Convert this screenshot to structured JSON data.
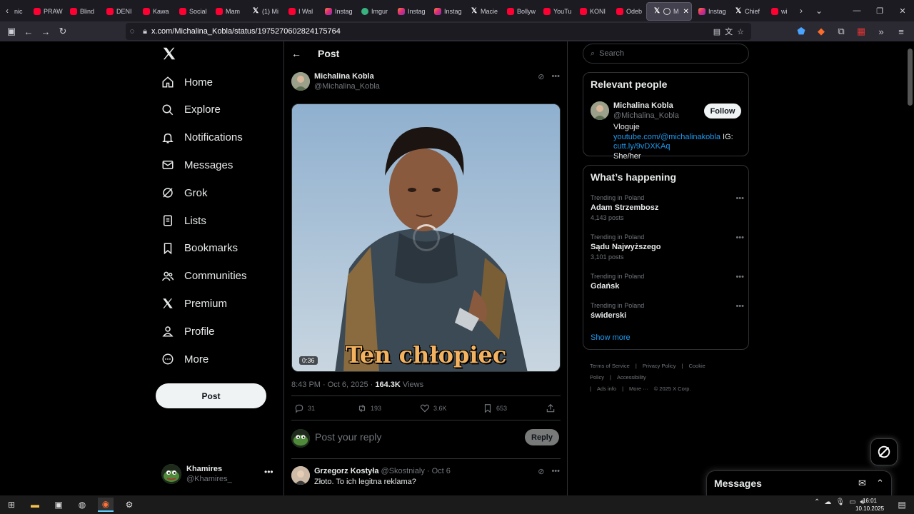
{
  "browser": {
    "tabs": [
      {
        "label": "nic",
        "icon": "tab-nav-left"
      },
      {
        "label": "PRAW",
        "icon": "youtube"
      },
      {
        "label": "Blind",
        "icon": "youtube"
      },
      {
        "label": "DENI",
        "icon": "youtube"
      },
      {
        "label": "Kawa",
        "icon": "youtube"
      },
      {
        "label": "Social",
        "icon": "youtube"
      },
      {
        "label": "Mam",
        "icon": "youtube"
      },
      {
        "label": "(1) Mi",
        "icon": "x"
      },
      {
        "label": "I Wal",
        "icon": "youtube"
      },
      {
        "label": "Instag",
        "icon": "instagram"
      },
      {
        "label": "Imgur",
        "icon": "imgur"
      },
      {
        "label": "Instag",
        "icon": "instagram"
      },
      {
        "label": "Instag",
        "icon": "instagram"
      },
      {
        "label": "Macie",
        "icon": "x"
      },
      {
        "label": "Bollyw",
        "icon": "youtube"
      },
      {
        "label": "YouTu",
        "icon": "youtube"
      },
      {
        "label": "KONI",
        "icon": "youtube"
      },
      {
        "label": "Odeb",
        "icon": "youtube"
      },
      {
        "label": "M",
        "icon": "x",
        "active": true
      },
      {
        "label": "Instag",
        "icon": "instagram"
      },
      {
        "label": "Chief",
        "icon": "x"
      },
      {
        "label": "wi",
        "icon": "youtube"
      }
    ],
    "url": "x.com/Michalina_Kobla/status/1975270602824175764"
  },
  "nav": {
    "items": [
      {
        "label": "Home",
        "icon": "home-icon"
      },
      {
        "label": "Explore",
        "icon": "search-icon"
      },
      {
        "label": "Notifications",
        "icon": "bell-icon"
      },
      {
        "label": "Messages",
        "icon": "envelope-icon"
      },
      {
        "label": "Grok",
        "icon": "grok-icon"
      },
      {
        "label": "Lists",
        "icon": "list-icon"
      },
      {
        "label": "Bookmarks",
        "icon": "bookmark-icon"
      },
      {
        "label": "Communities",
        "icon": "people-icon"
      },
      {
        "label": "Premium",
        "icon": "x-icon"
      },
      {
        "label": "Profile",
        "icon": "person-icon"
      },
      {
        "label": "More",
        "icon": "more-circle-icon"
      }
    ],
    "post_label": "Post",
    "account": {
      "name": "Khamires",
      "handle": "@Khamires_"
    }
  },
  "post": {
    "header_title": "Post",
    "author_name": "Michalina Kobla",
    "author_handle": "@Michalina_Kobla",
    "video_caption": "Ten chłopiec",
    "video_duration": "0:36",
    "timestamp": "8:43 PM · Oct 6, 2025 · ",
    "views_count": "164.3K",
    "views_label": " Views",
    "replies": "31",
    "reposts": "193",
    "likes": "3.6K",
    "bookmarks": "653",
    "reply_placeholder": "Post your reply",
    "reply_button": "Reply"
  },
  "reply": {
    "name": "Grzegorz Kostyła",
    "handle": "@Skostnialy · Oct 6",
    "text": "Złoto. To ich legitna reklama?"
  },
  "sidebar": {
    "search_placeholder": "Search",
    "relevant_title": "Relevant people",
    "person_name": "Michalina Kobla",
    "person_handle": "@Michalina_Kobla",
    "follow_label": "Follow",
    "bio_prefix": "Vloguje ",
    "bio_link1": "youtube.com/@michalinakobla",
    "bio_mid": " IG: ",
    "bio_link2": "cutt.ly/9vDXKAq",
    "bio_suffix": "She/her",
    "happening_title": "What’s happening",
    "trends": [
      {
        "context": "Trending in Poland",
        "title": "Adam Strzembosz",
        "count": "4,143 posts"
      },
      {
        "context": "Trending in Poland",
        "title": "Sądu Najwyższego",
        "count": "3,101 posts"
      },
      {
        "context": "Trending in Poland",
        "title": "Gdańsk",
        "count": ""
      },
      {
        "context": "Trending in Poland",
        "title": "świderski",
        "count": ""
      }
    ],
    "show_more": "Show more",
    "footer": [
      "Terms of Service",
      "|",
      "Privacy Policy",
      "|",
      "Cookie Policy",
      "|",
      "Accessibility",
      "|",
      "Ads info",
      "|",
      "More ···",
      "© 2025 X Corp."
    ]
  },
  "messages_drawer": {
    "title": "Messages"
  },
  "taskbar": {
    "time": "16:01",
    "date": "10.10.2025"
  },
  "colors": {
    "accent": "#1d9bf0",
    "bg": "#000000",
    "border": "#2f3336",
    "muted": "#71767b"
  }
}
